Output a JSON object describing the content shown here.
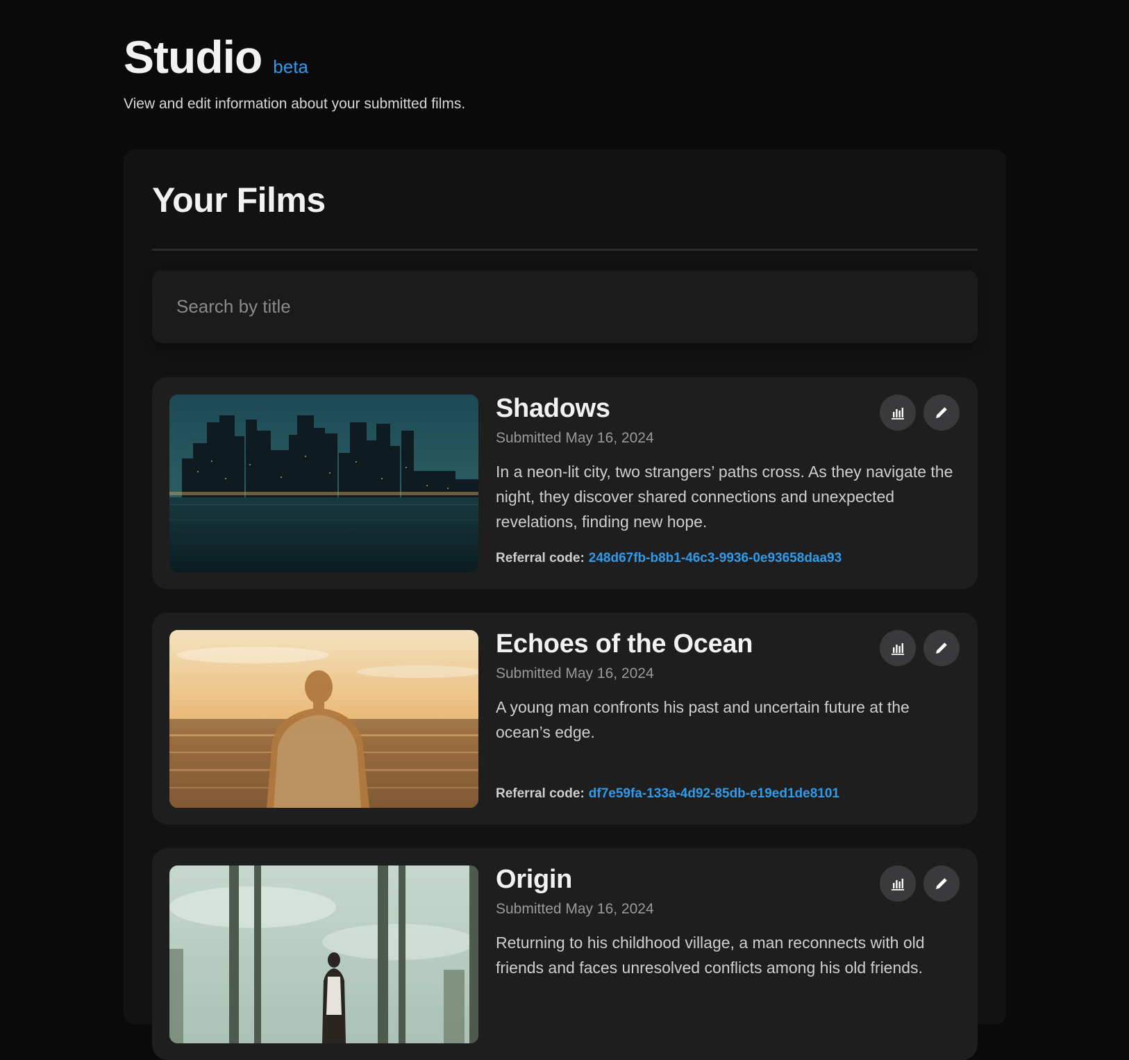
{
  "header": {
    "title": "Studio",
    "badge": "beta",
    "subtitle": "View and edit information about your submitted films."
  },
  "panel": {
    "title": "Your Films",
    "search_placeholder": "Search by title"
  },
  "films": [
    {
      "title": "Shadows",
      "submitted": "Submitted May 16, 2024",
      "description": "In a neon-lit city, two strangers’ paths cross. As they navigate the night, they discover shared connections and unexpected revelations, finding new hope.",
      "referral_label": "Referral code:",
      "referral_code": "248d67fb-b8b1-46c3-9936-0e93658daa93"
    },
    {
      "title": "Echoes of the Ocean",
      "submitted": "Submitted May 16, 2024",
      "description": "A young man confronts his past and uncertain future at the ocean’s edge.",
      "referral_label": "Referral code:",
      "referral_code": "df7e59fa-133a-4d92-85db-e19ed1de8101"
    },
    {
      "title": "Origin",
      "submitted": "Submitted May 16, 2024",
      "description": "Returning to his childhood village, a man reconnects with old friends and faces unresolved conflicts among his old friends.",
      "referral_label": "",
      "referral_code": ""
    }
  ],
  "icons": {
    "stats": "bar-chart-icon",
    "edit": "pencil-icon"
  },
  "colors": {
    "background": "#0a0a0b",
    "panel": "#121213",
    "card": "#1e1e1f",
    "accent": "#2f9bea",
    "icon_button": "#3a3a3c"
  }
}
